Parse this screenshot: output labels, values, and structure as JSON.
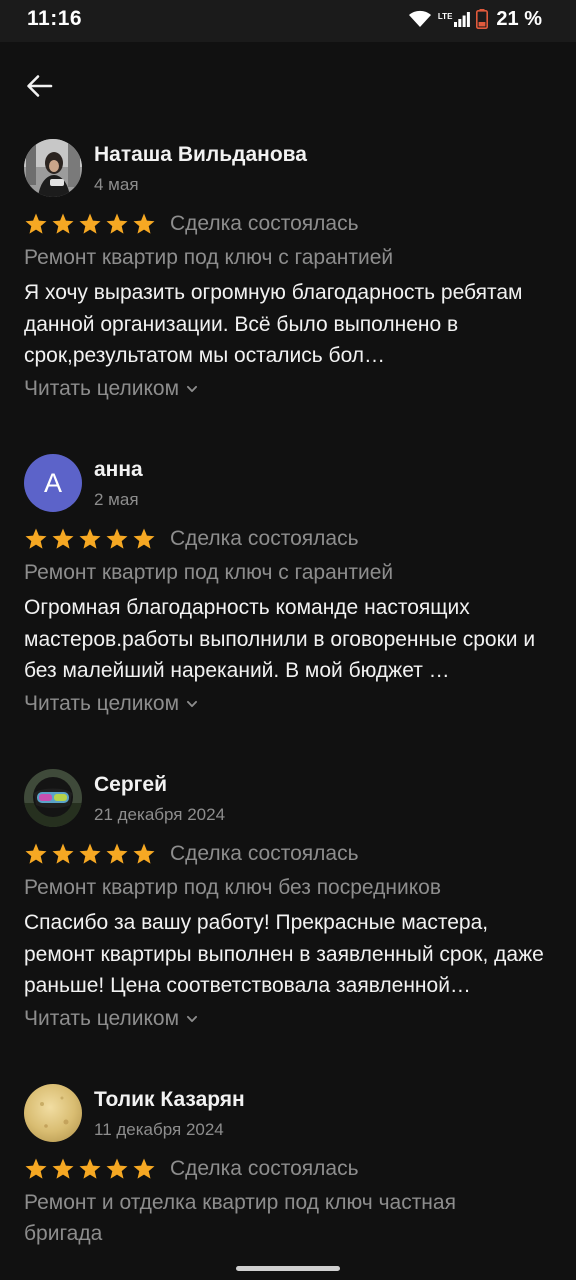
{
  "status_bar": {
    "time": "11:16",
    "network": "LTE",
    "battery": "21 %"
  },
  "nav": {
    "back_icon": "arrow-left-icon"
  },
  "colors": {
    "background": "#111111",
    "star": "#f6a823",
    "muted_text": "#8d8d8d",
    "avatar_letter_bg": "#5c63c9"
  },
  "reviews": [
    {
      "name": "Наташа Вильданова",
      "date": "4 мая",
      "rating": 5,
      "deal_status": "Сделка состоялась",
      "service": "Ремонт квартир под ключ с гарантией",
      "text": "Я хочу выразить огромную благодарность ребятам данной организации. Всё было выполнено в срок,результатом мы остались бол…",
      "read_more": "Читать целиком"
    },
    {
      "name": "анна",
      "avatar_letter": "А",
      "date": "2 мая",
      "rating": 5,
      "deal_status": "Сделка состоялась",
      "service": "Ремонт квартир под ключ с гарантией",
      "text": "Огромная благодарность команде настоящих мастеров.работы выполнили  в оговоренные сроки и без малейший нареканий. В мой бюджет …",
      "read_more": "Читать целиком"
    },
    {
      "name": "Сергей",
      "date": "21 декабря 2024",
      "rating": 5,
      "deal_status": "Сделка состоялась",
      "service": "Ремонт квартир под ключ без посредников",
      "text": "Спасибо за вашу работу! Прекрасные мастера, ремонт квартиры выполнен в заявленный срок, даже раньше! Цена соответствовала заявленной…",
      "read_more": "Читать целиком"
    },
    {
      "name": "Толик Казарян",
      "date": "11 декабря 2024",
      "rating": 5,
      "deal_status": "Сделка состоялась",
      "service": "Ремонт и отделка квартир под ключ частная бригада"
    }
  ]
}
